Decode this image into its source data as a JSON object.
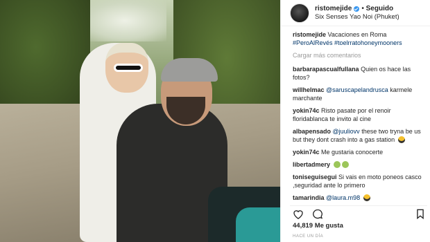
{
  "post": {
    "username": "ristomejide",
    "follow_label": "Seguido",
    "location": "Six Senses Yao Noi (Phuket)",
    "caption_user": "ristomejide",
    "caption_text": "Vacaciones en Roma",
    "caption_tags": "#PeroAlRevés #toelrratohoneymooners",
    "load_more": "Cargar más comentarios"
  },
  "comments": [
    {
      "user": "barbarapascualfullana",
      "text": "Quien os hace las fotos?"
    },
    {
      "user": "willhelmac",
      "mention": "@saruscapelandrusca",
      "text": " karmele marchante"
    },
    {
      "user": "yokin74c",
      "text": "Risto pasate por el renoir floridablanca te invito al cine"
    },
    {
      "user": "albapensado",
      "mention": "@juuliovv",
      "text": " these two tryna be us but they dont crash into a gas station",
      "emoji": "cool"
    },
    {
      "user": "yokin74c",
      "text": "Me gustaria conocerte"
    },
    {
      "user": "libertadmery",
      "text": "",
      "emoji": "cry"
    },
    {
      "user": "toniseguisegui",
      "text": "Si vais en moto poneos casco ,seguridad ante lo primero"
    },
    {
      "user": "tamarindia",
      "mention": "@laura.m98",
      "text": "",
      "emoji": "cool"
    }
  ],
  "footer": {
    "likes_count": "44,819",
    "likes_label": "Me gusta",
    "time_ago": "HACE UN DÍA"
  },
  "icons": {
    "like": "heart-icon",
    "comment": "comment-bubble-icon",
    "save": "bookmark-icon",
    "verified": "verified-badge-icon"
  },
  "colors": {
    "link": "#003569",
    "verified": "#3897f0",
    "muted": "#999999"
  }
}
